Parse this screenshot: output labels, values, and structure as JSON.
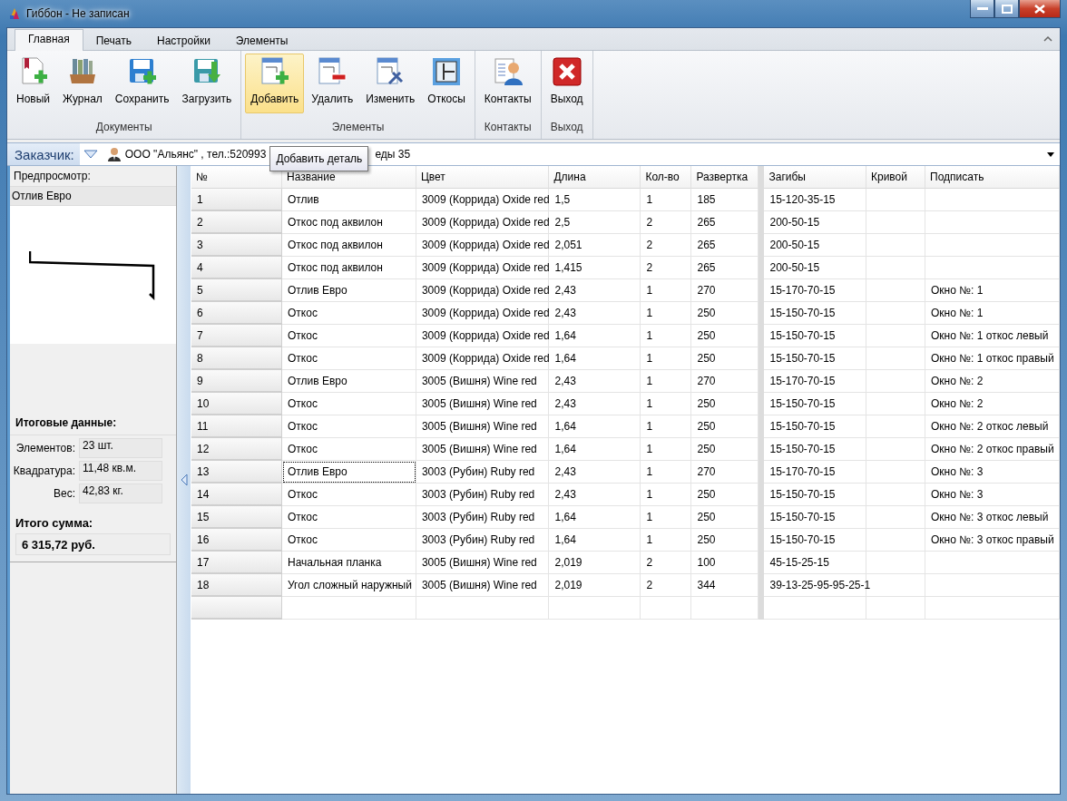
{
  "window": {
    "title": "Гиббон - Не записан"
  },
  "tabs": [
    {
      "label": "Главная",
      "selected": true
    },
    {
      "label": "Печать",
      "selected": false
    },
    {
      "label": "Настройки",
      "selected": false
    },
    {
      "label": "Элементы",
      "selected": false
    }
  ],
  "ribbon_groups": [
    {
      "label": "Документы",
      "buttons": [
        {
          "label": "Новый",
          "kind": "new",
          "highlighted": false
        },
        {
          "label": "Журнал",
          "kind": "journal",
          "highlighted": false
        },
        {
          "label": "Сохранить",
          "kind": "save",
          "highlighted": false
        },
        {
          "label": "Загрузить",
          "kind": "load",
          "highlighted": false
        }
      ]
    },
    {
      "label": "Элементы",
      "buttons": [
        {
          "label": "Добавить",
          "kind": "add",
          "highlighted": true
        },
        {
          "label": "Удалить",
          "kind": "delete",
          "highlighted": false
        },
        {
          "label": "Изменить",
          "kind": "edit",
          "highlighted": false
        },
        {
          "label": "Откосы",
          "kind": "slopes",
          "highlighted": false
        }
      ]
    },
    {
      "label": "Контакты",
      "buttons": [
        {
          "label": "Контакты",
          "kind": "contacts",
          "highlighted": false
        }
      ]
    },
    {
      "label": "Выход",
      "buttons": [
        {
          "label": "Выход",
          "kind": "exit",
          "highlighted": false
        }
      ]
    }
  ],
  "customer": {
    "label": "Заказчик:",
    "value_start": "ООО \"Альянс\" , тел.:520993",
    "value_end": "еды 35",
    "tooltip": "Добавить деталь"
  },
  "preview": {
    "heading": "Предпросмотр:",
    "item": "Отлив Евро"
  },
  "totals": {
    "heading": "Итоговые данные:",
    "fields": [
      {
        "label": "Элементов:",
        "value": "23 шт."
      },
      {
        "label": "Квадратура:",
        "value": "11,48 кв.м."
      },
      {
        "label": "Вес:",
        "value": "42,83 кг."
      }
    ],
    "sum_label": "Итого сумма:",
    "sum_value": "6 315,72 руб."
  },
  "table": {
    "columns": [
      "№",
      "Название",
      "Цвет",
      "Длина",
      "Кол-во",
      "Развертка",
      "Загибы",
      "Кривой",
      "Подписать"
    ],
    "rows": [
      {
        "cells": [
          "1",
          "Отлив",
          "3009 (Коррида) Oxide red",
          "1,5",
          "1",
          "185",
          "15-120-35-15",
          "",
          ""
        ],
        "focused": false
      },
      {
        "cells": [
          "2",
          "Откос под аквилон",
          "3009 (Коррида) Oxide red",
          "2,5",
          "2",
          "265",
          "200-50-15",
          "",
          ""
        ],
        "focused": false
      },
      {
        "cells": [
          "3",
          "Откос под аквилон",
          "3009 (Коррида) Oxide red",
          "2,051",
          "2",
          "265",
          "200-50-15",
          "",
          ""
        ],
        "focused": false
      },
      {
        "cells": [
          "4",
          "Откос под аквилон",
          "3009 (Коррида) Oxide red",
          "1,415",
          "2",
          "265",
          "200-50-15",
          "",
          ""
        ],
        "focused": false
      },
      {
        "cells": [
          "5",
          "Отлив Евро",
          "3009 (Коррида) Oxide red",
          "2,43",
          "1",
          "270",
          "15-170-70-15",
          "",
          "Окно №: 1"
        ],
        "focused": false
      },
      {
        "cells": [
          "6",
          "Откос",
          "3009 (Коррида) Oxide red",
          "2,43",
          "1",
          "250",
          "15-150-70-15",
          "",
          "Окно №: 1"
        ],
        "focused": false
      },
      {
        "cells": [
          "7",
          "Откос",
          "3009 (Коррида) Oxide red",
          "1,64",
          "1",
          "250",
          "15-150-70-15",
          "",
          "Окно №: 1 откос левый"
        ],
        "focused": false
      },
      {
        "cells": [
          "8",
          "Откос",
          "3009 (Коррида) Oxide red",
          "1,64",
          "1",
          "250",
          "15-150-70-15",
          "",
          "Окно №: 1 откос правый"
        ],
        "focused": false
      },
      {
        "cells": [
          "9",
          "Отлив Евро",
          "3005 (Вишня) Wine red",
          "2,43",
          "1",
          "270",
          "15-170-70-15",
          "",
          "Окно №: 2"
        ],
        "focused": false
      },
      {
        "cells": [
          "10",
          "Откос",
          "3005 (Вишня) Wine red",
          "2,43",
          "1",
          "250",
          "15-150-70-15",
          "",
          "Окно №: 2"
        ],
        "focused": false
      },
      {
        "cells": [
          "11",
          "Откос",
          "3005 (Вишня) Wine red",
          "1,64",
          "1",
          "250",
          "15-150-70-15",
          "",
          "Окно №: 2 откос левый"
        ],
        "focused": false
      },
      {
        "cells": [
          "12",
          "Откос",
          "3005 (Вишня) Wine red",
          "1,64",
          "1",
          "250",
          "15-150-70-15",
          "",
          "Окно №: 2 откос правый"
        ],
        "focused": false
      },
      {
        "cells": [
          "13",
          "Отлив Евро",
          "3003 (Рубин) Ruby red",
          "2,43",
          "1",
          "270",
          "15-170-70-15",
          "",
          "Окно №: 3"
        ],
        "focused": true
      },
      {
        "cells": [
          "14",
          "Откос",
          "3003 (Рубин) Ruby red",
          "2,43",
          "1",
          "250",
          "15-150-70-15",
          "",
          "Окно №: 3"
        ],
        "focused": false
      },
      {
        "cells": [
          "15",
          "Откос",
          "3003 (Рубин) Ruby red",
          "1,64",
          "1",
          "250",
          "15-150-70-15",
          "",
          "Окно №: 3 откос левый"
        ],
        "focused": false
      },
      {
        "cells": [
          "16",
          "Откос",
          "3003 (Рубин) Ruby red",
          "1,64",
          "1",
          "250",
          "15-150-70-15",
          "",
          "Окно №: 3 откос правый"
        ],
        "focused": false
      },
      {
        "cells": [
          "17",
          "Начальная планка",
          "3005 (Вишня) Wine red",
          "2,019",
          "2",
          "100",
          "45-15-25-15",
          "",
          ""
        ],
        "focused": false
      },
      {
        "cells": [
          "18",
          "Угол сложный наружный",
          "3005 (Вишня) Wine red",
          "2,019",
          "2",
          "344",
          "39-13-25-95-95-25-1",
          "",
          ""
        ],
        "focused": false
      }
    ]
  }
}
